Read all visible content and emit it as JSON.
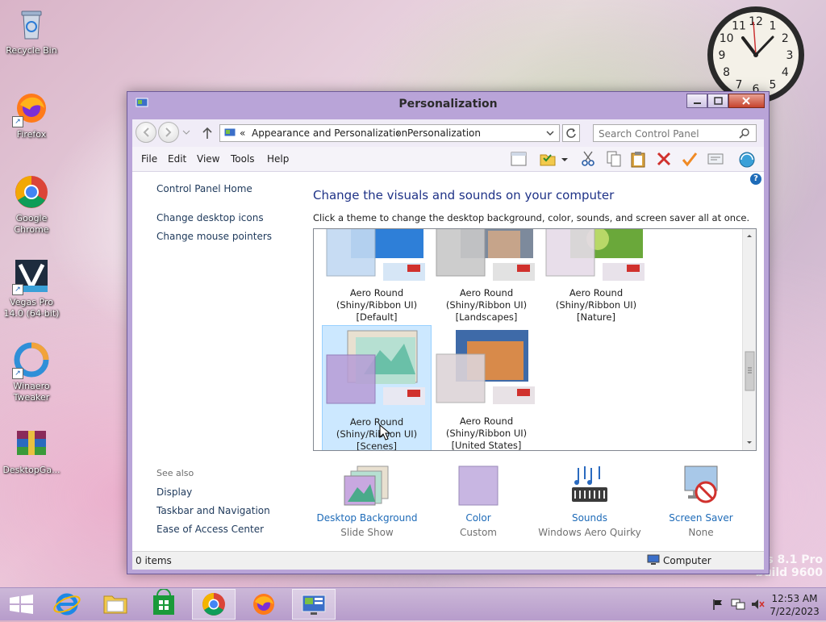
{
  "desktop": {
    "icons": [
      {
        "label": "Recycle Bin",
        "icon": "recycle-bin-icon"
      },
      {
        "label": "Firefox",
        "icon": "firefox-icon"
      },
      {
        "label": "Google Chrome",
        "icon": "chrome-icon"
      },
      {
        "label": "Vegas Pro 14.0 (64-bit)",
        "icon": "vegas-pro-icon"
      },
      {
        "label": "Winaero Tweaker",
        "icon": "winaero-tweaker-icon"
      },
      {
        "label": "DesktopGa...",
        "icon": "winrar-archive-icon"
      }
    ],
    "watermark": {
      "line1": "s 8.1 Pro",
      "line2": "build 9600"
    },
    "clock_numbers": [
      "12",
      "1",
      "2",
      "3",
      "4",
      "5",
      "6",
      "7",
      "8",
      "9",
      "10",
      "11"
    ]
  },
  "window": {
    "title": "Personalization",
    "address": {
      "overflow": "«",
      "crumbs": [
        "Appearance and Personalization",
        "Personalization"
      ],
      "separator": "›"
    },
    "search": {
      "placeholder": "Search Control Panel"
    },
    "menu": [
      "File",
      "Edit",
      "View",
      "Tools",
      "Help"
    ],
    "toolbar_icons": [
      "layout-icon",
      "folder-options-icon",
      "cut-icon",
      "copy-icon",
      "paste-icon",
      "delete-icon",
      "check-icon",
      "properties-icon",
      "shell-icon"
    ],
    "help_glyph": "?",
    "sidebar": {
      "home": "Control Panel Home",
      "links": [
        "Change desktop icons",
        "Change mouse pointers"
      ],
      "see_also_title": "See also",
      "see_also": [
        "Display",
        "Taskbar and Navigation",
        "Ease of Access Center"
      ]
    },
    "heading": "Change the visuals and sounds on your computer",
    "description": "Click a theme to change the desktop background, color, sounds, and screen saver all at once.",
    "themes": [
      {
        "line1": "Aero Round",
        "line2": "(Shiny/Ribbon UI)",
        "line3": "[Default]",
        "selected": false
      },
      {
        "line1": "Aero Round",
        "line2": "(Shiny/Ribbon UI)",
        "line3": "[Landscapes]",
        "selected": false
      },
      {
        "line1": "Aero Round",
        "line2": "(Shiny/Ribbon UI)",
        "line3": "[Nature]",
        "selected": false
      },
      {
        "line1": "Aero Round",
        "line2": "(Shiny/Ribbon UI)",
        "line3": "[Scenes]",
        "selected": true
      },
      {
        "line1": "Aero Round",
        "line2": "(Shiny/Ribbon UI)",
        "line3": "[United States]",
        "selected": false
      }
    ],
    "bottom": [
      {
        "name": "Desktop Background",
        "value": "Slide Show",
        "icon": "desktop-background-icon"
      },
      {
        "name": "Color",
        "value": "Custom",
        "icon": "color-swatch-icon",
        "swatch": "#c8b6e2"
      },
      {
        "name": "Sounds",
        "value": "Windows Aero Quirky",
        "icon": "sounds-icon"
      },
      {
        "name": "Screen Saver",
        "value": "None",
        "icon": "screen-saver-icon"
      }
    ],
    "status": {
      "items": "0 items",
      "location": "Computer"
    }
  },
  "taskbar": {
    "apps": [
      "start-icon",
      "internet-explorer-icon",
      "file-explorer-icon",
      "store-icon",
      "chrome-icon",
      "firefox-icon",
      "control-panel-icon"
    ],
    "time": "12:53 AM",
    "date": "7/22/2023"
  },
  "colors": {
    "accent": "#b9a4d8",
    "link": "#1e6bb8",
    "heading": "#1e3287",
    "selection": "#cce8ff"
  }
}
